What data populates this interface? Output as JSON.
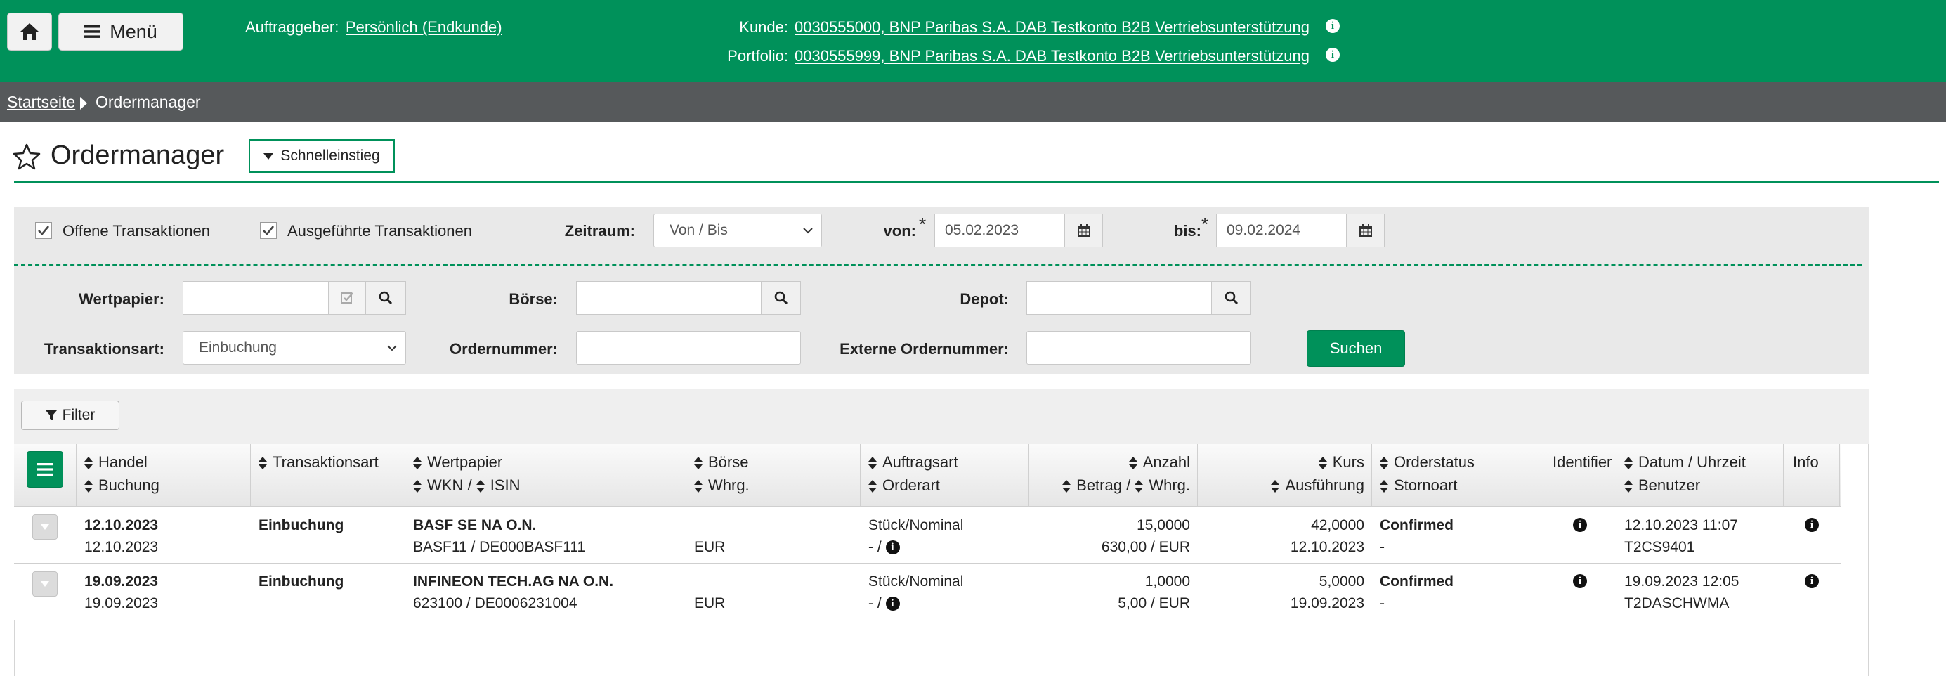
{
  "header": {
    "menu_label": "Menü",
    "auftraggeber_label": "Auftraggeber:",
    "auftraggeber_value": "Persönlich (Endkunde)",
    "kunde_label": "Kunde:",
    "kunde_value": "0030555000, BNP Paribas S.A. DAB Testkonto B2B Vertriebsunterstützung",
    "portfolio_label": "Portfolio:",
    "portfolio_value": "0030555999, BNP Paribas S.A. DAB Testkonto B2B Vertriebsunterstützung",
    "info_glyph": "i"
  },
  "breadcrumb": {
    "home": "Startseite",
    "current": "Ordermanager"
  },
  "page": {
    "title": "Ordermanager",
    "quick_label": "Schnelleinstieg"
  },
  "filters": {
    "offene_label": "Offene Transaktionen",
    "ausgefuehrte_label": "Ausgeführte Transaktionen",
    "zeitraum_label": "Zeitraum:",
    "zeitraum_value": "Von / Bis",
    "von_label": "von:",
    "von_value": "05.02.2023",
    "bis_label": "bis:",
    "bis_value": "09.02.2024",
    "required_mark": "*",
    "wertpapier_label": "Wertpapier:",
    "boerse_label": "Börse:",
    "depot_label": "Depot:",
    "transaktionsart_label": "Transaktionsart:",
    "transaktionsart_value": "Einbuchung",
    "ordernummer_label": "Ordernummer:",
    "externe_label": "Externe Ordernummer:",
    "search_button": "Suchen"
  },
  "filter_button": "Filter",
  "table": {
    "headers": {
      "handel": "Handel",
      "buchung": "Buchung",
      "transaktionsart": "Transaktionsart",
      "wertpapier": "Wertpapier",
      "wkn": "WKN /",
      "isin": "ISIN",
      "boerse": "Börse",
      "whrg": "Whrg.",
      "auftragsart": "Auftragsart",
      "orderart": "Orderart",
      "anzahl": "Anzahl",
      "betrag": "Betrag /",
      "betrag_whrg": "Whrg.",
      "kurs": "Kurs",
      "ausfuehrung": "Ausführung",
      "orderstatus": "Orderstatus",
      "stornoart": "Stornoart",
      "identifier": "Identifier",
      "datum": "Datum / Uhrzeit",
      "benutzer": "Benutzer",
      "info": "Info"
    },
    "rows": [
      {
        "handel": "12.10.2023",
        "buchung": "12.10.2023",
        "transaktionsart": "Einbuchung",
        "wertpapier": "BASF SE NA O.N.",
        "wkn_isin": "BASF11 / DE000BASF111",
        "boerse": "",
        "whrg": "EUR",
        "auftragsart": "Stück/Nominal",
        "orderart": "- /",
        "anzahl": "15,0000",
        "betrag": "630,00 / EUR",
        "kurs": "42,0000",
        "ausfuehrung": "12.10.2023",
        "orderstatus": "Confirmed",
        "stornoart": "-",
        "datum": "12.10.2023 11:07",
        "benutzer": "T2CS9401"
      },
      {
        "handel": "19.09.2023",
        "buchung": "19.09.2023",
        "transaktionsart": "Einbuchung",
        "wertpapier": "INFINEON TECH.AG NA O.N.",
        "wkn_isin": "623100 / DE0006231004",
        "boerse": "",
        "whrg": "EUR",
        "auftragsart": "Stück/Nominal",
        "orderart": "- /",
        "anzahl": "1,0000",
        "betrag": "5,00 / EUR",
        "kurs": "5,0000",
        "ausfuehrung": "19.09.2023",
        "orderstatus": "Confirmed",
        "stornoart": "-",
        "datum": "19.09.2023 12:05",
        "benutzer": "T2DASCHWMA"
      }
    ]
  },
  "colors": {
    "brand_green": "#00915a",
    "breadcrumb_bg": "#56595b",
    "panel_bg": "#e9e9e9"
  }
}
